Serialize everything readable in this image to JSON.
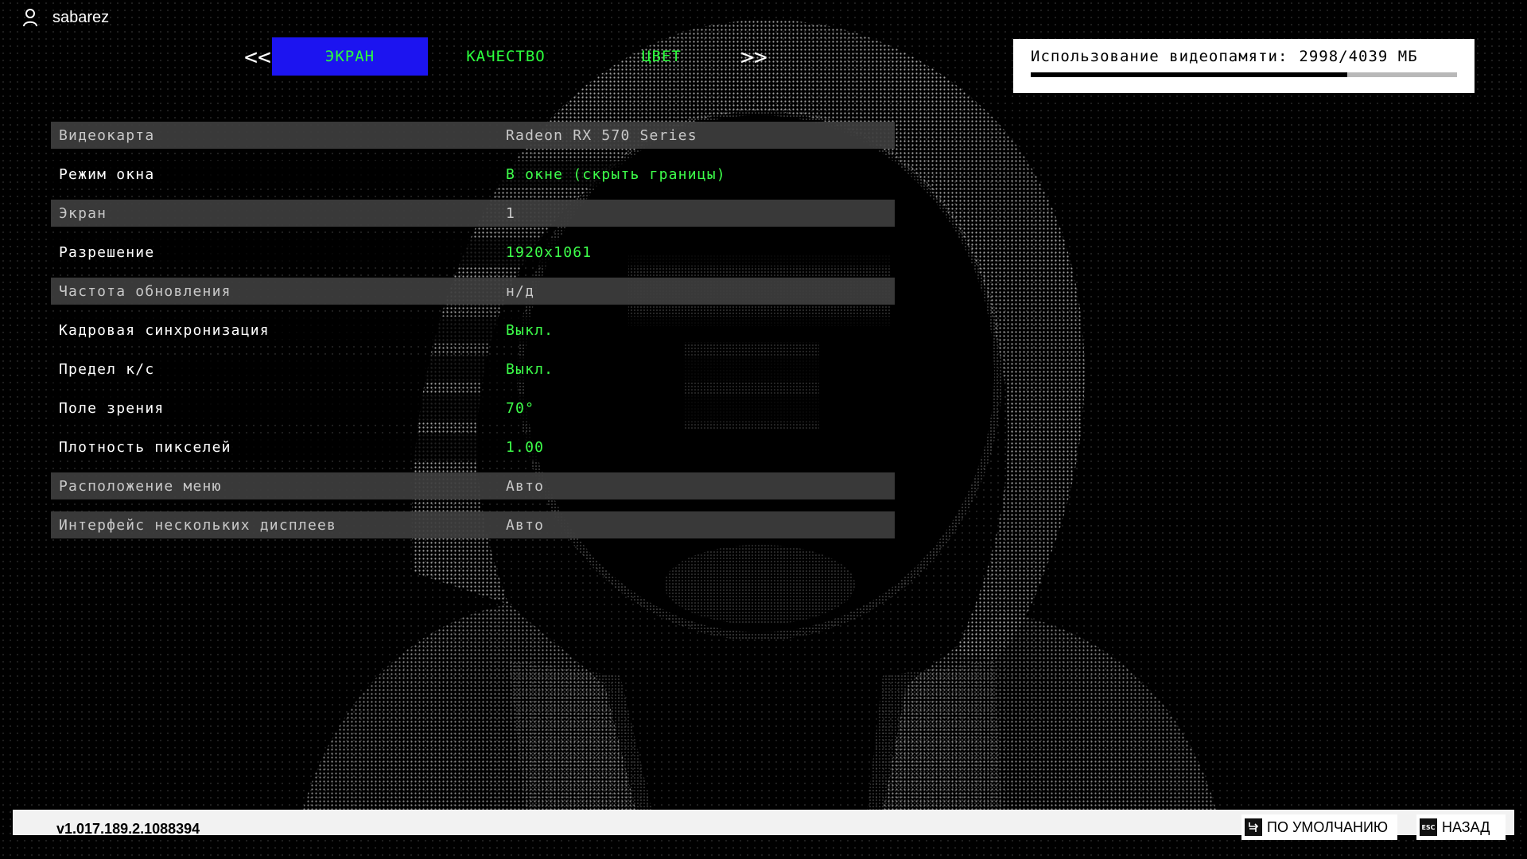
{
  "user": {
    "name": "sabarez",
    "icon": "user-icon"
  },
  "tabs": {
    "prev": "<<",
    "next": ">>",
    "items": [
      {
        "label": "ЭКРАН",
        "active": true
      },
      {
        "label": "КАЧЕСТВО",
        "active": false
      },
      {
        "label": "ЦВЕТ",
        "active": false
      }
    ]
  },
  "vram": {
    "label": "Использование видеопамяти:",
    "value": "2998/4039 МБ",
    "used": 2998,
    "total": 4039
  },
  "settings": [
    {
      "label": "Видеокарта",
      "value": "Radeon RX 570 Series",
      "enabled": false
    },
    {
      "label": "Режим окна",
      "value": "В окне (скрыть границы)",
      "enabled": true
    },
    {
      "label": "Экран",
      "value": "1",
      "enabled": false
    },
    {
      "label": "Разрешение",
      "value": "1920x1061",
      "enabled": true
    },
    {
      "label": "Частота обновления",
      "value": "н/д",
      "enabled": false
    },
    {
      "label": "Кадровая синхронизация",
      "value": "Выкл.",
      "enabled": true
    },
    {
      "label": "Предел к/с",
      "value": "Выкл.",
      "enabled": true
    },
    {
      "label": "Поле зрения",
      "value": "70°",
      "enabled": true
    },
    {
      "label": "Плотность пикселей",
      "value": "1.00",
      "enabled": true
    },
    {
      "label": "Расположение меню",
      "value": "Авто",
      "enabled": false
    },
    {
      "label": "Интерфейс нескольких дисплеев",
      "value": "Авто",
      "enabled": false
    }
  ],
  "footer": {
    "version": "v1.017.189.2.1088394",
    "default_label": "ПО УМОЛЧАНИЮ",
    "back_label": "НАЗАД",
    "back_key": "ESC"
  },
  "colors": {
    "accent_green": "#3dff4a",
    "tab_active_bg": "#1c14f0",
    "background": "#000000"
  }
}
